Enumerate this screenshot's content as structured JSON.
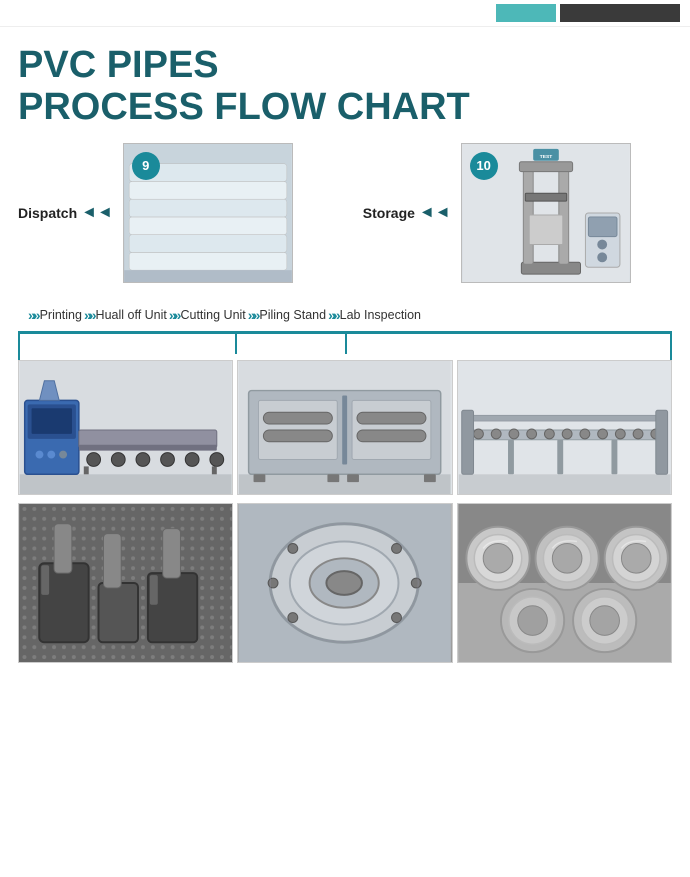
{
  "header": {
    "title_line1": "PVC PIPES",
    "title_line2": "PROCESS FLOW CHART"
  },
  "top_items": [
    {
      "step": "9",
      "label": "Dispatch",
      "arrows": "◄◄"
    },
    {
      "step": "10",
      "label": "Storage",
      "arrows": "◄◄"
    }
  ],
  "process_steps": [
    {
      "label": "Printing"
    },
    {
      "label": "Huall off Unit"
    },
    {
      "label": "Cutting Unit"
    },
    {
      "label": "Piling Stand"
    },
    {
      "label": "Lab Inspection"
    }
  ],
  "colors": {
    "teal": "#1a7a8a",
    "teal_light": "#4db8b8",
    "dark": "#3a3a3a",
    "title": "#1a5f6a"
  }
}
